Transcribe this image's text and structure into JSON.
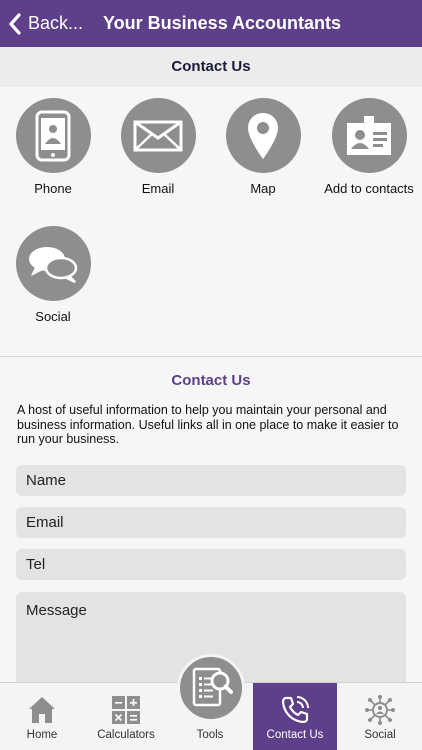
{
  "header": {
    "back_label": "Back...",
    "title": "Your Business Accountants",
    "background": "#5d3f8a"
  },
  "section_title": "Contact Us",
  "tiles": [
    {
      "label": "Phone",
      "icon": "phone-icon"
    },
    {
      "label": "Email",
      "icon": "email-icon"
    },
    {
      "label": "Map",
      "icon": "map-pin-icon"
    },
    {
      "label": "Add to contacts",
      "icon": "contact-card-icon"
    },
    {
      "label": "Social",
      "icon": "chat-bubbles-icon"
    }
  ],
  "form": {
    "title": "Contact Us",
    "intro": "A host of useful information to help you maintain your personal and business information. Useful links all in one place to make it easier to run your business.",
    "fields": {
      "name": "Name",
      "email": "Email",
      "tel": "Tel",
      "message": "Message"
    }
  },
  "tabbar": {
    "home": "Home",
    "calculators": "Calculators",
    "tools": "Tools",
    "contact": "Contact Us",
    "social": "Social",
    "active_tab": "Contact Us",
    "accent": "#5d3f8a"
  }
}
